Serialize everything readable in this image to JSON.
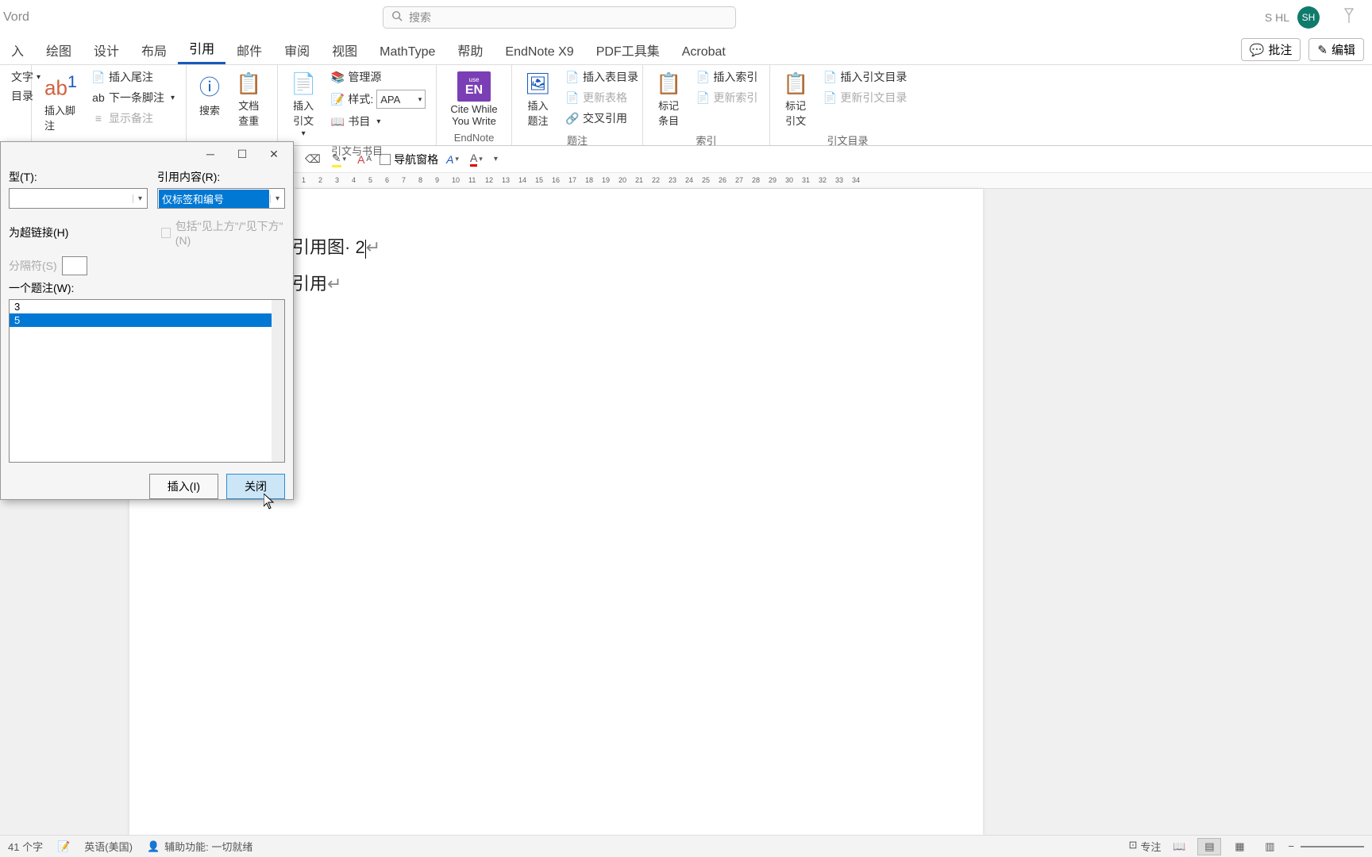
{
  "title_bar": {
    "app_title": "Vord",
    "search_placeholder": "搜索",
    "user_name": "S HL",
    "avatar_initials": "SH"
  },
  "tabs": {
    "items": [
      "入",
      "绘图",
      "设计",
      "布局",
      "引用",
      "邮件",
      "审阅",
      "视图",
      "MathType",
      "帮助",
      "EndNote X9",
      "PDF工具集",
      "Acrobat"
    ],
    "active_index": 4,
    "comments_btn": "批注",
    "edit_btn": "编辑"
  },
  "ribbon": {
    "group0": {
      "btn_text": "文字",
      "btn_list": "目录"
    },
    "group1": {
      "big_btn": "插入脚注",
      "insert_endnote": "插入尾注",
      "next_footnote": "下一条脚注",
      "show_notes": "显示备注"
    },
    "group2": {
      "search": "搜索",
      "rewrite": "文档查重"
    },
    "group3": {
      "insert_citation": "插入引文",
      "manage_sources": "管理源",
      "style_label": "样式:",
      "style_value": "APA",
      "bibliography": "书目",
      "group_label": "引文与书目"
    },
    "group4": {
      "cite_while": "Cite While You Write",
      "group_label": "EndNote"
    },
    "group5": {
      "insert_caption": "插入题注",
      "insert_tof": "插入表目录",
      "update_table": "更新表格",
      "cross_ref": "交叉引用",
      "group_label": "题注"
    },
    "group6": {
      "mark_entry": "标记条目",
      "insert_index": "插入索引",
      "update_index": "更新索引",
      "group_label": "索引"
    },
    "group7": {
      "mark_citation": "标记引文",
      "insert_toa": "插入引文目录",
      "update_toa": "更新引文目录",
      "group_label": "引文目录"
    }
  },
  "sec_toolbar": {
    "nav_pane": "导航窗格"
  },
  "ruler_ticks": [
    "1",
    "2",
    "3",
    "4",
    "5",
    "6",
    "7",
    "8",
    "9",
    "10",
    "11",
    "12",
    "13",
    "14",
    "15",
    "16",
    "17",
    "18",
    "19",
    "20",
    "21",
    "22",
    "23",
    "24",
    "25",
    "26",
    "27",
    "28",
    "29",
    "30",
    "31",
    "32",
    "33",
    "34"
  ],
  "document": {
    "line1": "引用图· 2",
    "line2": "引用"
  },
  "dialog": {
    "type_label": "型(T):",
    "content_label": "引用内容(R):",
    "content_value": "仅标签和编号",
    "hyperlink_label": "为超链接(H)",
    "include_above_below": "包括\"见上方\"/\"见下方\"(N)",
    "separator_label": "分隔符(S)",
    "which_caption_label": "一个题注(W):",
    "list_items": [
      "3",
      "5"
    ],
    "selected_index": 1,
    "insert_btn": "插入(I)",
    "close_btn": "关闭"
  },
  "status": {
    "word_count": "41 个字",
    "language": "英语(美国)",
    "accessibility": "辅助功能: 一切就绪",
    "focus": "专注"
  }
}
